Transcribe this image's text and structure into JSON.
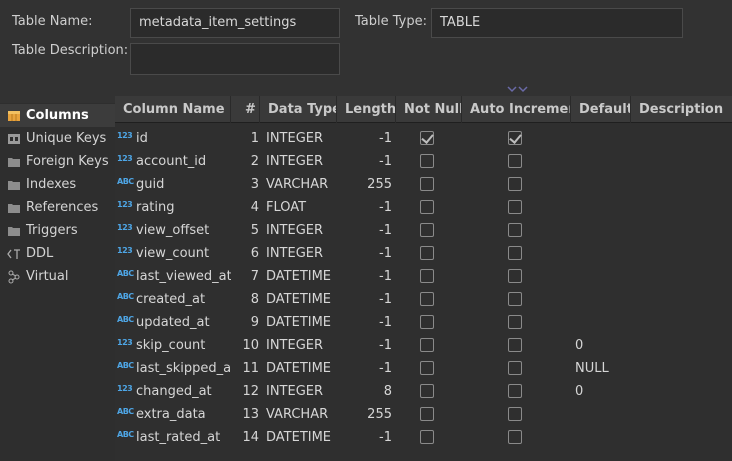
{
  "header": {
    "table_name_label": "Table Name:",
    "table_name_value": "metadata_item_settings",
    "table_type_label": "Table Type:",
    "table_type_value": "TABLE",
    "table_desc_label": "Table Description:",
    "table_desc_value": ""
  },
  "sidebar": {
    "items": [
      {
        "label": "Columns",
        "icon": "columns-icon",
        "active": true
      },
      {
        "label": "Unique Keys",
        "icon": "unique-key-icon",
        "active": false
      },
      {
        "label": "Foreign Keys",
        "icon": "folder-icon",
        "active": false
      },
      {
        "label": "Indexes",
        "icon": "folder-icon",
        "active": false
      },
      {
        "label": "References",
        "icon": "folder-icon",
        "active": false
      },
      {
        "label": "Triggers",
        "icon": "folder-icon",
        "active": false
      },
      {
        "label": "DDL",
        "icon": "ddl-icon",
        "active": false
      },
      {
        "label": "Virtual",
        "icon": "virtual-icon",
        "active": false
      }
    ]
  },
  "grid": {
    "headers": [
      "Column Name",
      "#",
      "Data Type",
      "Length",
      "Not Null",
      "Auto Increment",
      "Default",
      "Description"
    ],
    "rows": [
      {
        "type_icon": "123",
        "name": "id",
        "num": "1",
        "data_type": "INTEGER",
        "length": "-1",
        "not_null": true,
        "auto_inc": true,
        "default": "",
        "description": ""
      },
      {
        "type_icon": "123",
        "name": "account_id",
        "num": "2",
        "data_type": "INTEGER",
        "length": "-1",
        "not_null": false,
        "auto_inc": false,
        "default": "",
        "description": ""
      },
      {
        "type_icon": "ABC",
        "name": "guid",
        "num": "3",
        "data_type": "VARCHAR",
        "length": "255",
        "not_null": false,
        "auto_inc": false,
        "default": "",
        "description": ""
      },
      {
        "type_icon": "123",
        "name": "rating",
        "num": "4",
        "data_type": "FLOAT",
        "length": "-1",
        "not_null": false,
        "auto_inc": false,
        "default": "",
        "description": ""
      },
      {
        "type_icon": "123",
        "name": "view_offset",
        "num": "5",
        "data_type": "INTEGER",
        "length": "-1",
        "not_null": false,
        "auto_inc": false,
        "default": "",
        "description": ""
      },
      {
        "type_icon": "123",
        "name": "view_count",
        "num": "6",
        "data_type": "INTEGER",
        "length": "-1",
        "not_null": false,
        "auto_inc": false,
        "default": "",
        "description": ""
      },
      {
        "type_icon": "ABC",
        "name": "last_viewed_at",
        "num": "7",
        "data_type": "DATETIME",
        "length": "-1",
        "not_null": false,
        "auto_inc": false,
        "default": "",
        "description": ""
      },
      {
        "type_icon": "ABC",
        "name": "created_at",
        "num": "8",
        "data_type": "DATETIME",
        "length": "-1",
        "not_null": false,
        "auto_inc": false,
        "default": "",
        "description": ""
      },
      {
        "type_icon": "ABC",
        "name": "updated_at",
        "num": "9",
        "data_type": "DATETIME",
        "length": "-1",
        "not_null": false,
        "auto_inc": false,
        "default": "",
        "description": ""
      },
      {
        "type_icon": "123",
        "name": "skip_count",
        "num": "10",
        "data_type": "INTEGER",
        "length": "-1",
        "not_null": false,
        "auto_inc": false,
        "default": "0",
        "description": ""
      },
      {
        "type_icon": "ABC",
        "name": "last_skipped_at",
        "num": "11",
        "data_type": "DATETIME",
        "length": "-1",
        "not_null": false,
        "auto_inc": false,
        "default": "NULL",
        "description": ""
      },
      {
        "type_icon": "123",
        "name": "changed_at",
        "num": "12",
        "data_type": "INTEGER",
        "length": "8",
        "not_null": false,
        "auto_inc": false,
        "default": "0",
        "description": ""
      },
      {
        "type_icon": "ABC",
        "name": "extra_data",
        "num": "13",
        "data_type": "VARCHAR",
        "length": "255",
        "not_null": false,
        "auto_inc": false,
        "default": "",
        "description": ""
      },
      {
        "type_icon": "ABC",
        "name": "last_rated_at",
        "num": "14",
        "data_type": "DATETIME",
        "length": "-1",
        "not_null": false,
        "auto_inc": false,
        "default": "",
        "description": ""
      }
    ]
  },
  "colors": {
    "background": "#323232",
    "header_bg": "#3a3a3a",
    "type_icon": "#4ea6e6",
    "columns_icon": "#e8a33d"
  }
}
